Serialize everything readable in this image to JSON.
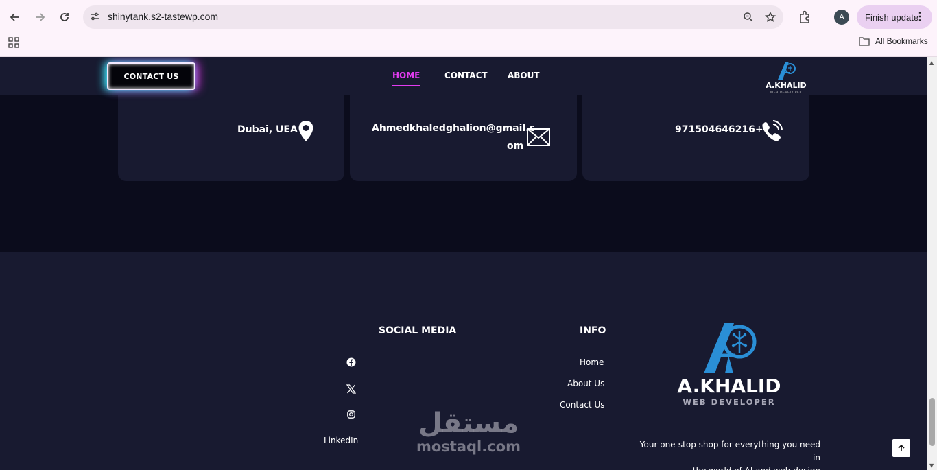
{
  "browser": {
    "url": "shinytank.s2-tastewp.com",
    "profile_initial": "A",
    "finish_update_label": "Finish update",
    "all_bookmarks_label": "All Bookmarks"
  },
  "header": {
    "cta_label": "CONTACT US",
    "menu": [
      "HOME",
      "CONTACT",
      "ABOUT"
    ],
    "active_item": "HOME",
    "logo_text": "A.KHALID",
    "logo_subtext": "WEB DEVELOPER"
  },
  "contact_cards": {
    "location": "Dubai, UEA",
    "email_line1": "Ahmedkhaledghalion@gmail.c",
    "email_line2": "om",
    "phone": "971504646216+"
  },
  "footer": {
    "social_title": "SOCIAL MEDIA",
    "social_linkedin": "LinkedIn",
    "info_title": "INFO",
    "info_links": [
      "Home",
      "About Us",
      "Contact Us"
    ],
    "logo_text": "A.KHALID",
    "logo_subtext": "WEB DEVELOPER",
    "tagline_line1": "Your one-stop shop for everything you need in",
    "tagline_line2": ".the world of AI and web design",
    "watermark_arabic": "مستقل",
    "watermark_latin": "mostaql.com"
  },
  "colors": {
    "accent_pink": "#e23cf0",
    "glow_cyan": "#2cf0f5",
    "logo_blue": "#2a8fd6",
    "panel": "#181a30",
    "background": "#0b0c1c"
  }
}
